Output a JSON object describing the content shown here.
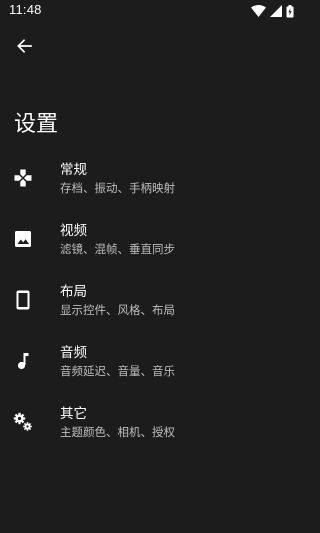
{
  "status_bar": {
    "time": "11:48",
    "icons": [
      "wifi-icon",
      "signal-icon",
      "battery-icon"
    ]
  },
  "header": {
    "back_icon": "arrow-left-icon",
    "title": "设置"
  },
  "menu": {
    "items": [
      {
        "icon": "gamepad-icon",
        "title": "常规",
        "subtitle": "存档、振动、手柄映射"
      },
      {
        "icon": "image-icon",
        "title": "视频",
        "subtitle": "滤镜、混帧、垂直同步"
      },
      {
        "icon": "phone-icon",
        "title": "布局",
        "subtitle": "显示控件、风格、布局"
      },
      {
        "icon": "music-note-icon",
        "title": "音频",
        "subtitle": "音频延迟、音量、音乐"
      },
      {
        "icon": "gears-icon",
        "title": "其它",
        "subtitle": "主题颜色、相机、授权"
      }
    ]
  },
  "colors": {
    "background": "#1c1c1c",
    "text_primary": "#ffffff",
    "text_secondary": "#bdbdbd"
  }
}
